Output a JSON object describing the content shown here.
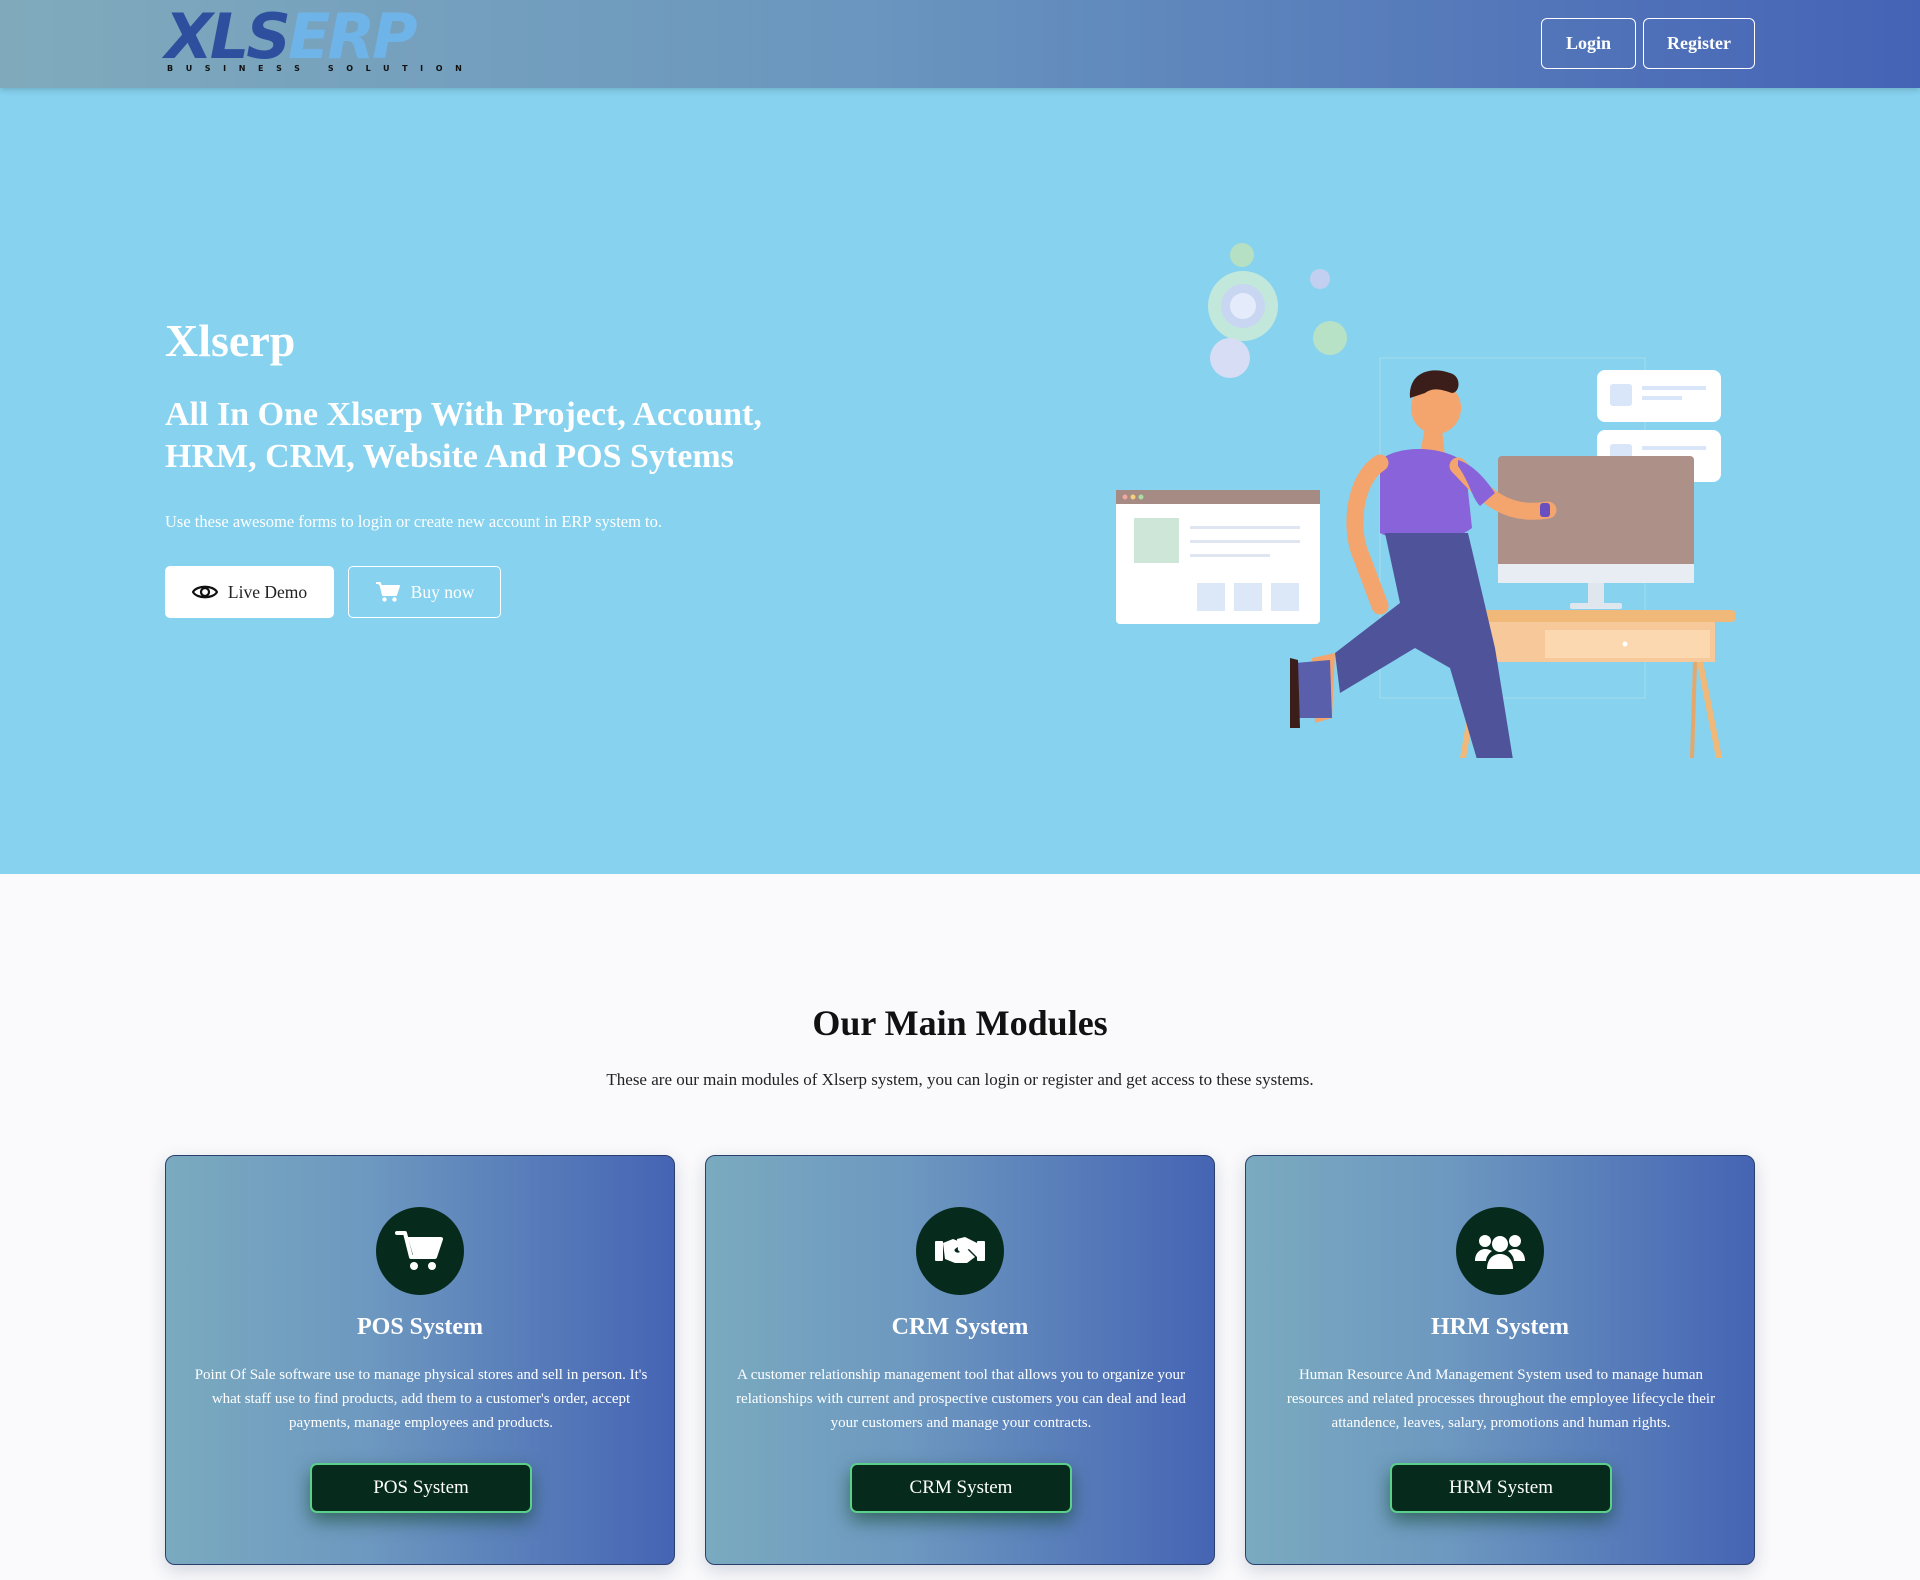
{
  "colors": {
    "nav_gradient_start": "#80aabc",
    "nav_gradient_end": "#4563b6",
    "hero_bg": "#86d2ef",
    "icon_circle": "#062b1c",
    "card_button_border": "#5ad08a"
  },
  "navbar": {
    "logo_part1": "XLS",
    "logo_part2": "ERP",
    "logo_tagline": "BUSINESS SOLUTION",
    "login_label": "Login",
    "register_label": "Register"
  },
  "hero": {
    "title": "Xlserp",
    "subtitle": "All In One Xlserp With Project, Account, HRM, CRM, Website And POS Sytems",
    "description": "Use these awesome forms to login or create new account in ERP system to.",
    "live_demo_label": "Live Demo",
    "live_demo_icon": "eye-icon",
    "buy_now_label": "Buy now",
    "buy_now_icon": "cart-icon"
  },
  "modules": {
    "title": "Our Main Modules",
    "description": "These are our main modules of Xlserp system, you can login or register and get access to these systems.",
    "cards": [
      {
        "icon": "cart-icon",
        "title": "POS System",
        "text": "Point Of Sale software use to manage physical stores and sell in person. It's what staff use to find products, add them to a customer's order, accept payments, manage employees and products.",
        "button": "POS System"
      },
      {
        "icon": "handshake-icon",
        "title": "CRM System",
        "text": "A customer relationship management tool that allows you to organize your relationships with current and prospective customers you can deal and lead your customers and manage your contracts.",
        "button": "CRM System"
      },
      {
        "icon": "users-icon",
        "title": "HRM System",
        "text": "Human Resource And Management System used to manage human resources and related processes throughout the employee lifecycle their attandence, leaves, salary, promotions and human rights.",
        "button": "HRM System"
      }
    ]
  }
}
